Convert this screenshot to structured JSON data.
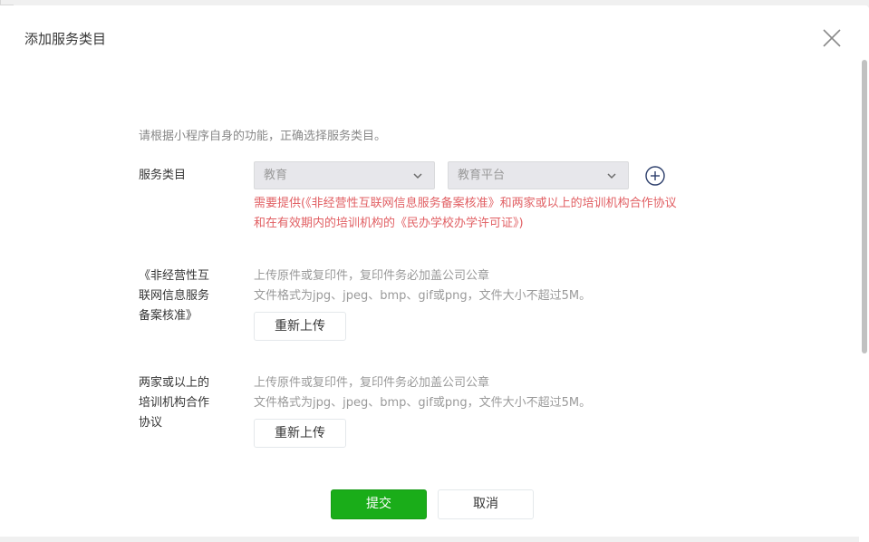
{
  "dialog": {
    "title": "添加服务类目"
  },
  "form": {
    "hint": "请根据小程序自身的功能，正确选择服务类目。",
    "category_label": "服务类目",
    "primary_select": {
      "selected": "教育"
    },
    "secondary_select": {
      "selected": "教育平台"
    },
    "warning_lines": [
      "需要提供(《非经营性互联网信息服务备案核准》和两家或以上的培训机构合作协议",
      "和在有效期内的培训机构的《民办学校办学许可证》)"
    ]
  },
  "uploads": [
    {
      "label_lines": [
        "《非经营性互",
        "联网信息服务",
        "备案核准》"
      ],
      "desc_lines": [
        "上传原件或复印件，复印件务必加盖公司公章",
        "文件格式为jpg、jpeg、bmp、gif或png，文件大小不超过5M。"
      ],
      "button_label": "重新上传"
    },
    {
      "label_lines": [
        "两家或以上的",
        "培训机构合作",
        "协议"
      ],
      "desc_lines": [
        "上传原件或复印件，复印件务必加盖公司公章",
        "文件格式为jpg、jpeg、bmp、gif或png，文件大小不超过5M。"
      ],
      "button_label": "重新上传"
    }
  ],
  "footer": {
    "submit_label": "提交",
    "cancel_label": "取消"
  },
  "colors": {
    "primary": "#1aad19",
    "warning": "#e15f63",
    "muted": "#9a9a9a",
    "text": "#353535"
  },
  "icons": {
    "close": "close-icon",
    "add": "plus-circle-icon",
    "chevron": "chevron-down-icon"
  }
}
